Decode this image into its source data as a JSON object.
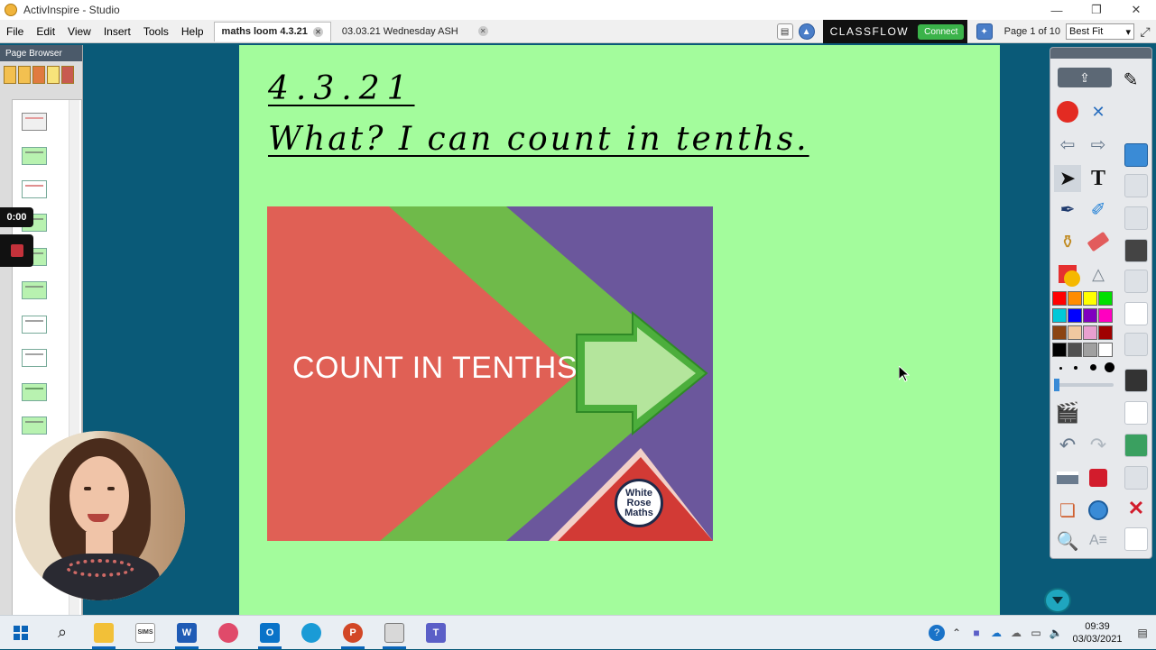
{
  "window": {
    "title": "ActivInspire - Studio",
    "minimize": "—",
    "maximize": "❐",
    "close": "✕"
  },
  "menu": [
    "File",
    "Edit",
    "View",
    "Insert",
    "Tools",
    "Help"
  ],
  "tabs": [
    {
      "label": "maths loom 4.3.21",
      "active": true
    },
    {
      "label": "03.03.21 Wednesday ASH",
      "active": false
    }
  ],
  "classflow": {
    "logo": "CLASSFLOW",
    "connect_label": "Connect"
  },
  "pagination": {
    "label": "Page 1 of 10"
  },
  "zoom": {
    "value": "Best Fit"
  },
  "page_browser": {
    "title": "Page Browser"
  },
  "recording": {
    "time": "0:00"
  },
  "flipchart": {
    "date_heading": "4.3.21",
    "objective_heading": "What? I can count in tenths."
  },
  "slide": {
    "text": "COUNT IN TENTHS",
    "logo_lines": [
      "White",
      "Rose",
      "Maths"
    ]
  },
  "colors": {
    "canvas_bg": "#a3fc9c",
    "slide_red": "#e06055",
    "slide_green": "#6fba4a",
    "slide_purple": "#6b579c",
    "desktop_bg": "#0a5a78"
  },
  "toolbox": {
    "palette": [
      "#ff0000",
      "#ff8c00",
      "#ffff00",
      "#00e000",
      "#00c8d8",
      "#0000ff",
      "#8000c0",
      "#ff00c0",
      "#8b4513",
      "#f0c8a0",
      "#e8a0d0",
      "#a00000",
      "#000000",
      "#505050",
      "#a0a0a0",
      "#ffffff"
    ]
  },
  "taskbar": {
    "apps": [
      "start-icon",
      "search-icon",
      "file-explorer-icon",
      "sims-icon",
      "word-icon",
      "snipping-icon",
      "outlook-icon",
      "edge-icon",
      "powerpoint-icon",
      "activinspire-icon",
      "teams-icon"
    ],
    "sims_label": "SIMS",
    "word_label": "W",
    "outlook_label": "O",
    "powerpoint_label": "P",
    "time": "09:39",
    "date": "03/03/2021"
  }
}
